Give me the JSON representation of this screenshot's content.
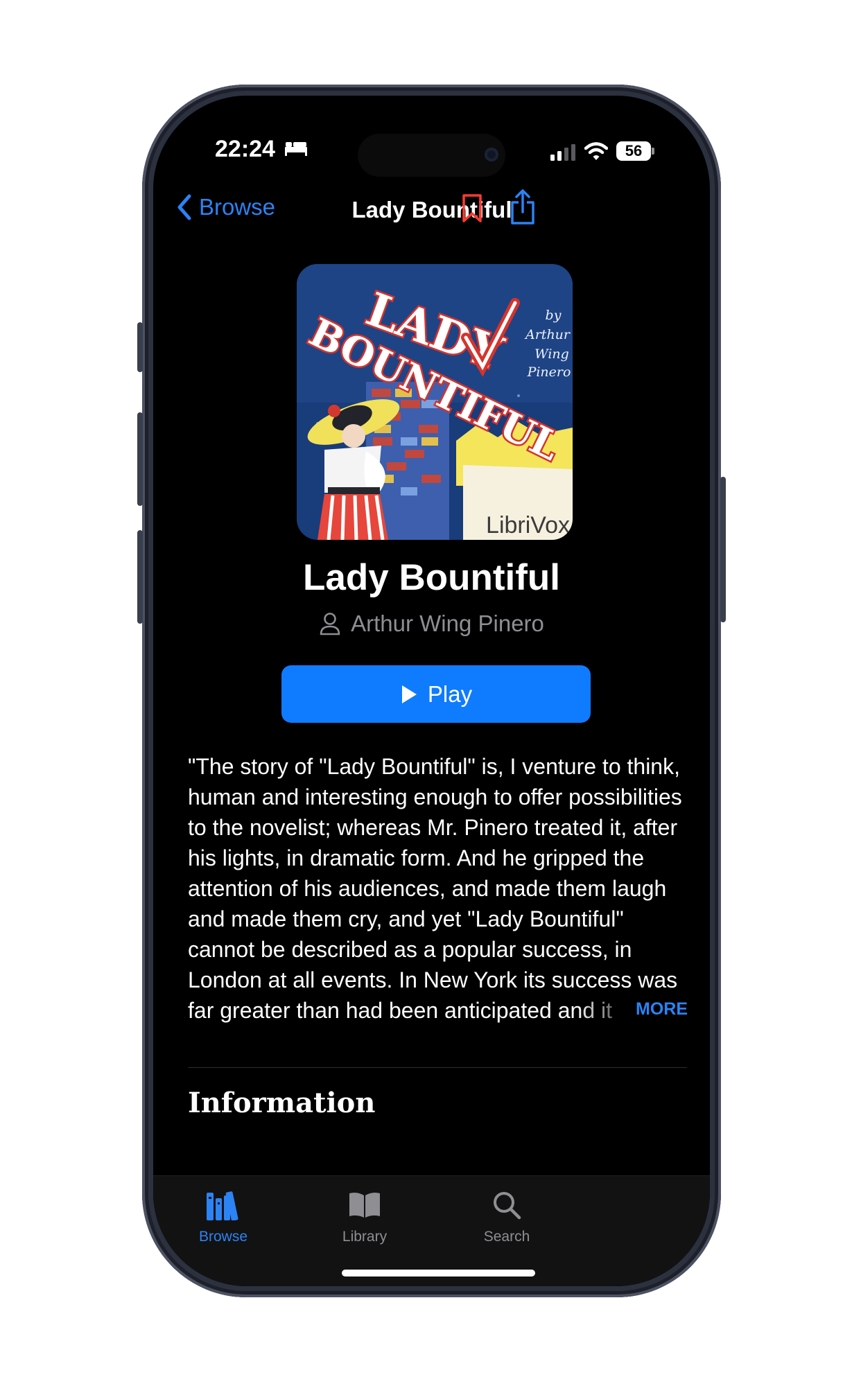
{
  "status_bar": {
    "time": "22:24",
    "battery": "56"
  },
  "nav": {
    "back_label": "Browse",
    "title": "Lady Bountiful"
  },
  "cover": {
    "title_line_1": "LADY",
    "title_line_2": "BOUNTIFUL",
    "byline": [
      "by",
      "Arthur",
      "Wing",
      "Pinero"
    ],
    "brand": "LibriVox"
  },
  "book": {
    "title": "Lady Bountiful",
    "author": "Arthur Wing Pinero"
  },
  "play_label": "Play",
  "description": "\"The story of \"Lady Bountiful\" is, I venture to think, human and interesting enough to offer possibilities to the novelist; whereas Mr. Pinero treated it, after his lights, in dramatic form. And he gripped the attention of his audiences, and made them laugh and made them cry, and yet \"Lady Bountiful\" cannot be described as a popular success, in London at all events. In New York its success was far greater than had been anticipated and it enjoyed quite a lor",
  "more_label": "MORE",
  "section_title": "Information",
  "tabs": [
    {
      "label": "Browse",
      "icon": "books-icon",
      "active": true
    },
    {
      "label": "Library",
      "icon": "open-book-icon",
      "active": false
    },
    {
      "label": "Search",
      "icon": "magnifier-icon",
      "active": false
    }
  ],
  "colors": {
    "accent": "#2b83f5",
    "play_button": "#0f7bff",
    "bookmark": "#ff3b30",
    "background": "#000000",
    "tab_inactive": "#8e8e93"
  }
}
